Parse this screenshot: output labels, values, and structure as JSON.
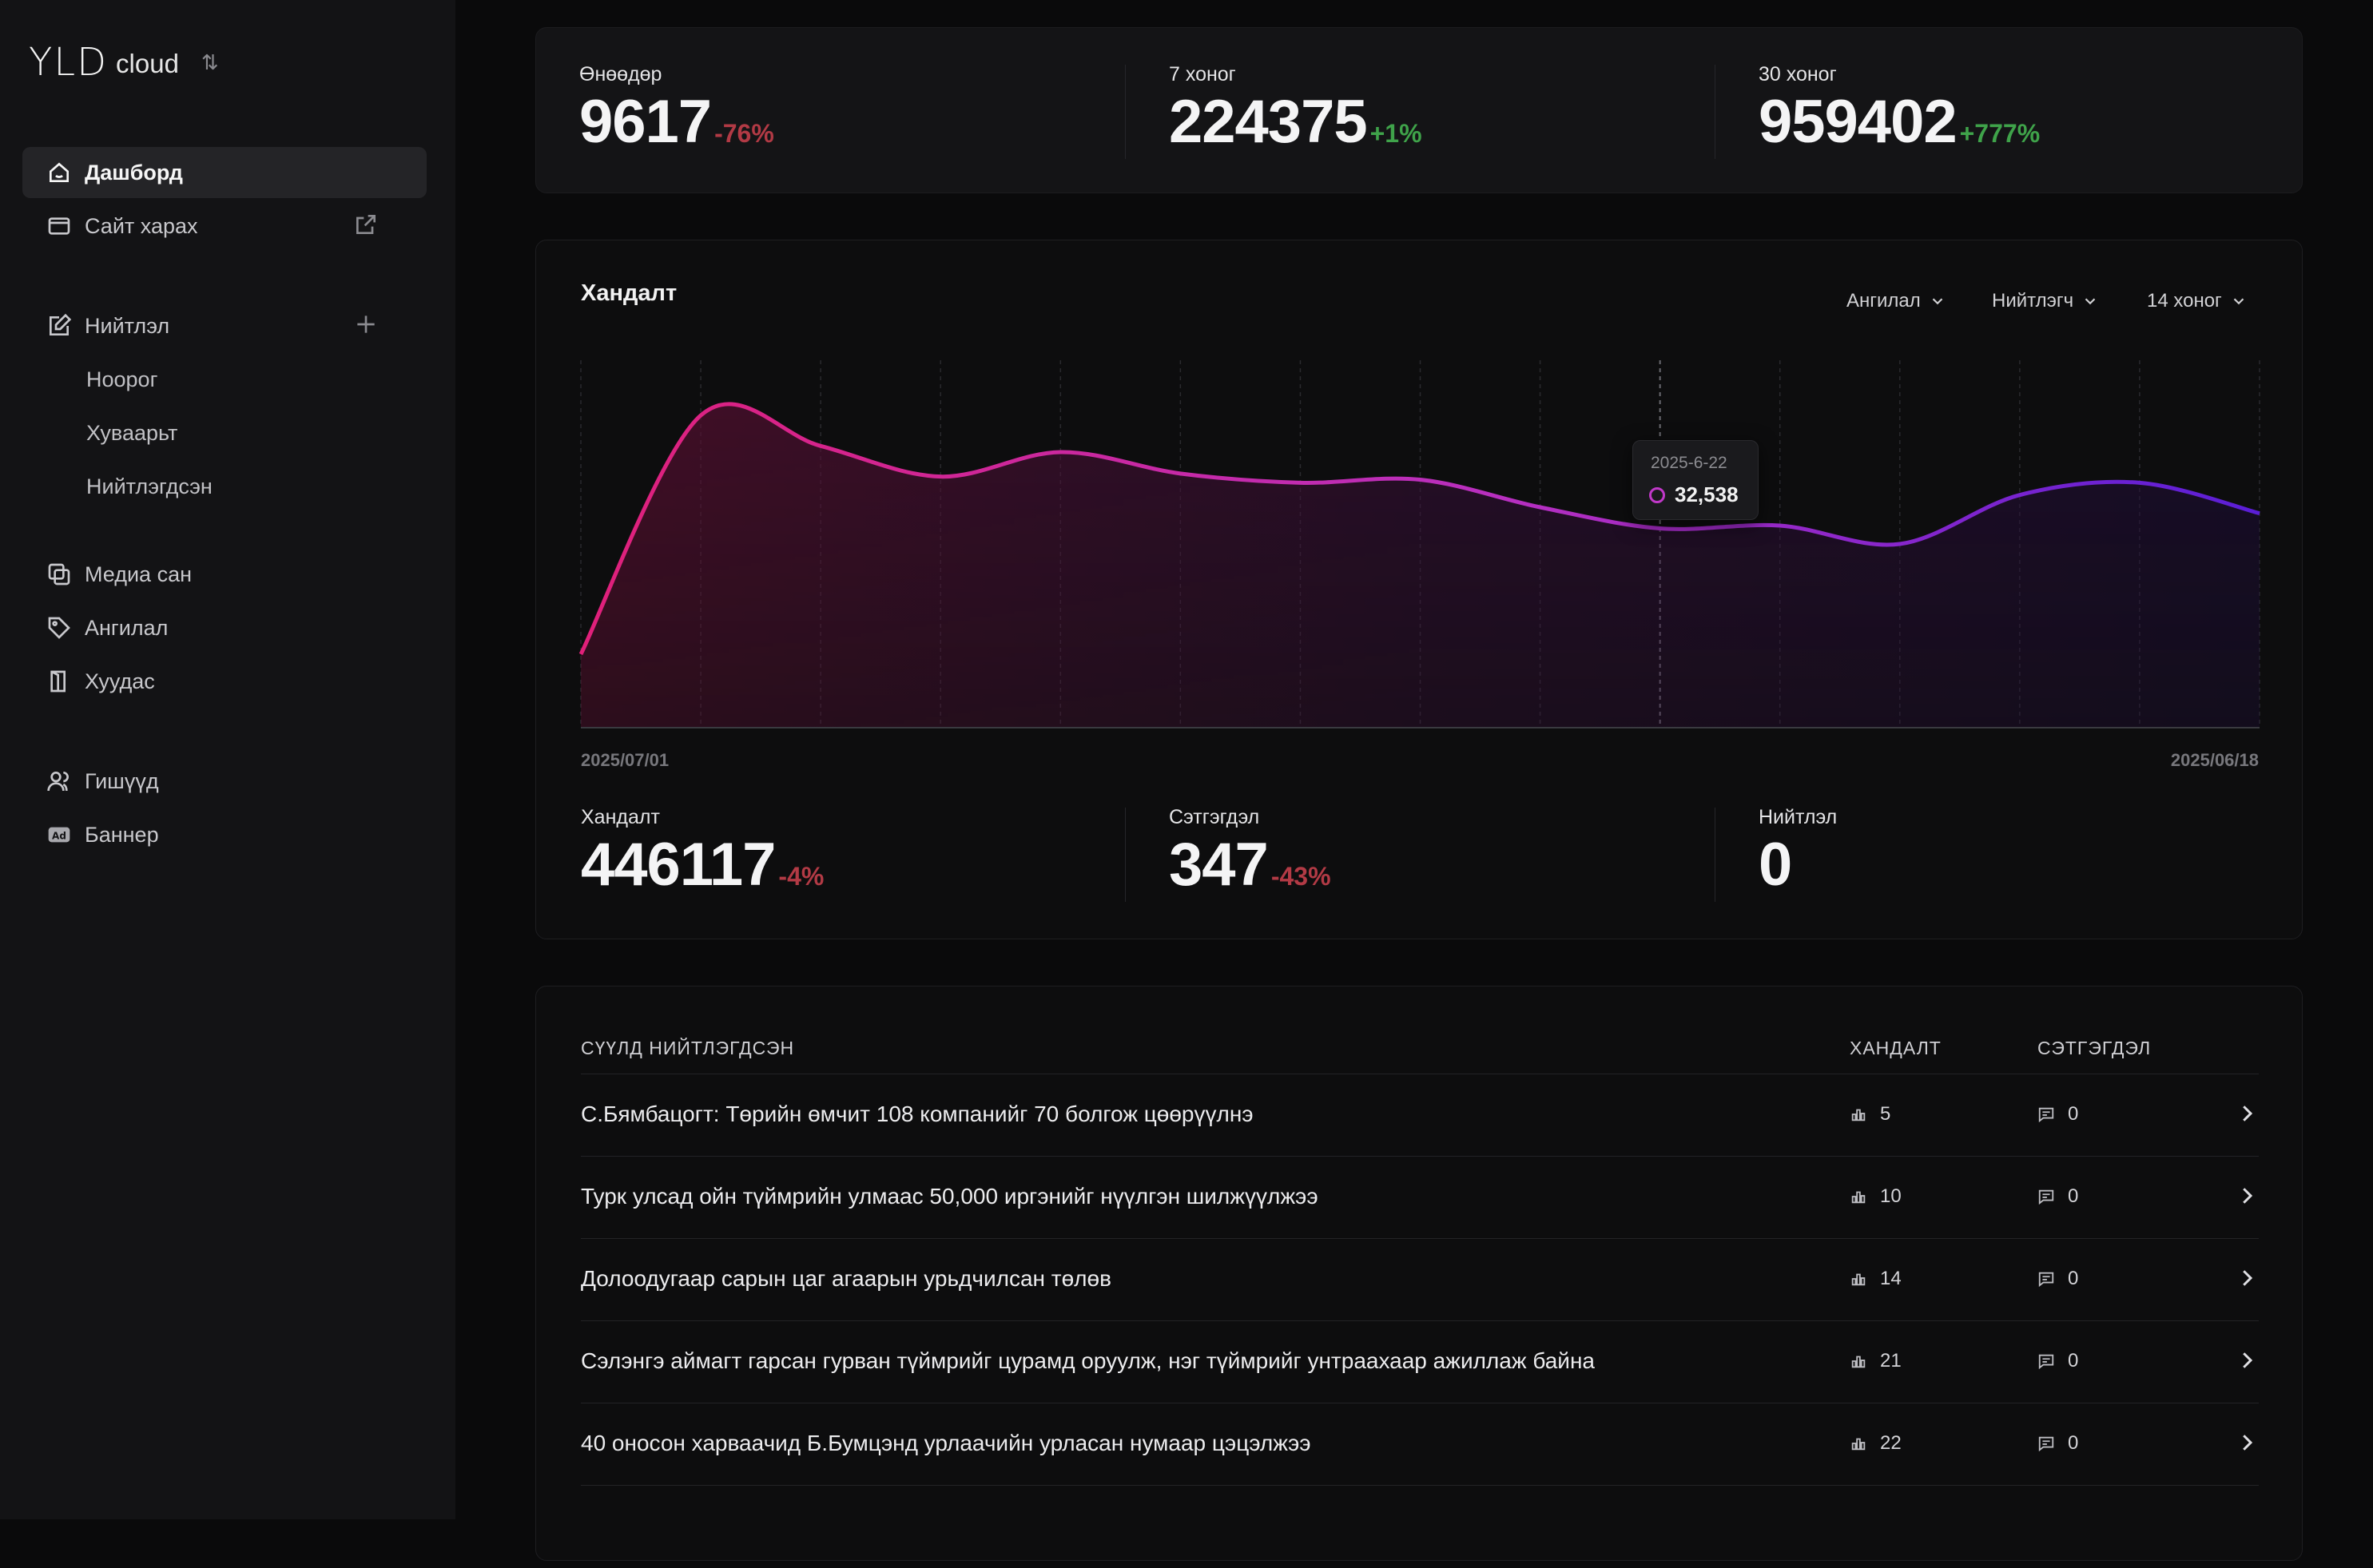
{
  "brand": {
    "logo": "YLD",
    "sub": "cloud"
  },
  "sidebar": {
    "main": [
      {
        "label": "Дашборд"
      },
      {
        "label": "Сайт харах"
      }
    ],
    "posts": {
      "label": "Нийтлэл",
      "sub": [
        "Ноорог",
        "Хуваарьт",
        "Нийтлэгдсэн"
      ]
    },
    "library": [
      {
        "label": "Медиа сан"
      },
      {
        "label": "Ангилал"
      },
      {
        "label": "Хуудас"
      }
    ],
    "admin": [
      {
        "label": "Гишүүд"
      },
      {
        "label": "Баннер"
      }
    ]
  },
  "top_stats": [
    {
      "label": "Өнөөдөр",
      "value": "9617",
      "change": "-76%"
    },
    {
      "label": "7 хоног",
      "value": "224375",
      "change": "+1%"
    },
    {
      "label": "30 хоног",
      "value": "959402",
      "change": "+777%"
    }
  ],
  "chart_card": {
    "title": "Хандалт",
    "filters": [
      "Ангилал",
      "Нийтлэгч",
      "14 хоног"
    ],
    "tooltip": {
      "date": "2025-6-22",
      "value": "32,538"
    },
    "x_start": "2025/07/01",
    "x_end": "2025/06/18",
    "stats": [
      {
        "label": "Хандалт",
        "value": "446117",
        "change": "-4%"
      },
      {
        "label": "Сэтгэгдэл",
        "value": "347",
        "change": "-43%"
      },
      {
        "label": "Нийтлэл",
        "value": "0",
        "change": ""
      }
    ]
  },
  "chart_data": {
    "type": "area",
    "x": [
      "2025/07/01",
      "",
      "",
      "",
      "",
      "",
      "",
      "",
      "",
      "2025-6-22",
      "",
      "",
      "",
      "",
      "2025/06/18"
    ],
    "values": [
      12000,
      51000,
      46000,
      41000,
      45000,
      41500,
      40000,
      40500,
      36000,
      32538,
      33000,
      30000,
      38000,
      40000,
      35000
    ],
    "xlabel": "",
    "ylabel": "",
    "grid": true,
    "colors": {
      "start": "#e0207a",
      "mid": "#b82fc0",
      "end": "#5a1ed6"
    }
  },
  "table": {
    "headers": {
      "title": "СҮҮЛД НИЙТЛЭГДСЭН",
      "views": "ХАНДАЛТ",
      "comments": "СЭТГЭГДЭЛ"
    },
    "rows": [
      {
        "title": "С.Бямбацогт: Төрийн өмчит 108 компанийг 70 болгож цөөрүүлнэ",
        "views": "5",
        "comments": "0"
      },
      {
        "title": "Турк улсад ойн түймрийн улмаас 50,000 иргэнийг нүүлгэн шилжүүлжээ",
        "views": "10",
        "comments": "0"
      },
      {
        "title": "Долоодугаар сарын цаг агаарын урьдчилсан төлөв",
        "views": "14",
        "comments": "0"
      },
      {
        "title": "Сэлэнгэ аймагт гарсан гурван түймрийг цурамд оруулж, нэг түймрийг унтраахаар ажиллаж байна",
        "views": "21",
        "comments": "0"
      },
      {
        "title": "40 оносон харваачид Б.Бумцэнд урлаачийн урласан нумаар цэцэлжээ",
        "views": "22",
        "comments": "0"
      }
    ]
  }
}
